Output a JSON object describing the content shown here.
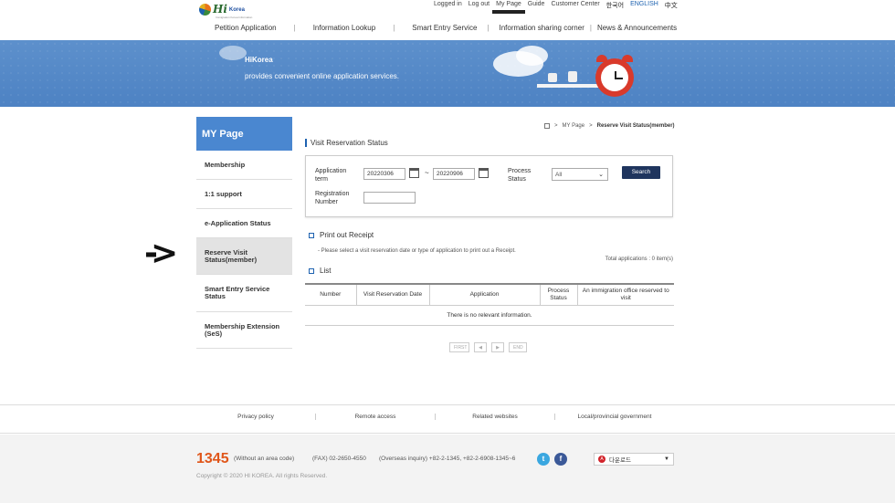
{
  "logo": {
    "hi": "Hi",
    "korea": "Korea",
    "tagline": "Immigration Korea Information"
  },
  "util_nav": {
    "logged_in": "Logged in",
    "logout": "Log out",
    "mypage": "My Page",
    "guide": "Guide",
    "customer": "Customer Center",
    "lang_ko": "한국어",
    "lang_en": "ENGLISH",
    "lang_zh": "中文"
  },
  "gnb": [
    "Petition Application",
    "Information Lookup",
    "Smart Entry Service",
    "Information sharing corner",
    "News & Announcements"
  ],
  "banner": {
    "title": "HiKorea",
    "desc": "provides convenient online application services."
  },
  "sidebar": {
    "title": "MY Page",
    "items": [
      "Membership",
      "1:1 support",
      "e-Application Status",
      "Reserve Visit Status(member)",
      "Smart Entry Service Status",
      "Membership Extension (SeS)"
    ]
  },
  "annotation_arrow": "->",
  "breadcrumb": {
    "mypage": "MY Page",
    "current": "Reserve Visit Status(member)"
  },
  "section_title": "Visit Reservation Status",
  "search": {
    "term_label": "Application term",
    "date_from": "20220306",
    "tilde": "~",
    "date_to": "20220906",
    "status_label": "Process Status",
    "status_value": "All",
    "reg_label": "Registration Number",
    "reg_value": "",
    "button": "Search"
  },
  "receipt": {
    "title": "Print out Receipt",
    "note": "- Please select a visit reservation date or type of application to print out a Receipt."
  },
  "total": "Total applications : 0 item(s)",
  "list": {
    "title": "List",
    "headers": [
      "Number",
      "Visit Reservation Date",
      "Application",
      "Process Status",
      "An immigration office reserved to visit"
    ],
    "empty": "There is no relevant information."
  },
  "pager": {
    "first": "FIRST",
    "prev": "◀",
    "next": "▶",
    "end": "END"
  },
  "footer": {
    "links": [
      "Privacy policy",
      "Remote access",
      "Related websites",
      "Local/provincial government"
    ],
    "phone": "1345",
    "phone_note": "(Without an area code)",
    "fax": "(FAX) 02-2650-4550",
    "overseas": "(Overseas inquiry) +82-2-1345, +82-2-6908-1345~6",
    "copyright": "Copyright © 2020 HI KOREA. All rights Reserved.",
    "download": "다운로드"
  },
  "colors": {
    "accent": "#4a87d0",
    "banner": "#5d90cc",
    "search_button": "#1f355e",
    "phone": "#e0561a"
  }
}
